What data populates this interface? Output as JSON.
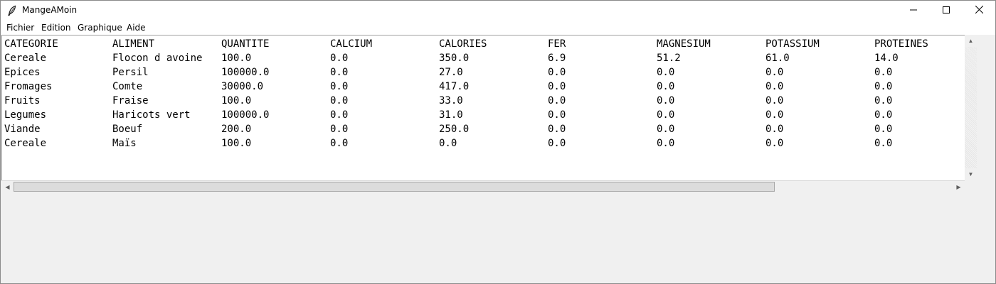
{
  "window": {
    "title": "MangeAMoin"
  },
  "menu": [
    "Fichier",
    "Edition",
    "Graphique",
    "Aide"
  ],
  "table": {
    "headers": [
      "CATEGORIE",
      "ALIMENT",
      "QUANTITE",
      "CALCIUM",
      "CALORIES",
      "FER",
      "MAGNESIUM",
      "POTASSIUM",
      "PROTEINES"
    ],
    "rows": [
      [
        "Cereale",
        "Flocon d avoine",
        "100.0",
        "0.0",
        "350.0",
        "6.9",
        "51.2",
        "61.0",
        "14.0"
      ],
      [
        "Epices",
        "Persil",
        "100000.0",
        "0.0",
        "27.0",
        "0.0",
        "0.0",
        "0.0",
        "0.0"
      ],
      [
        "Fromages",
        "Comte",
        "30000.0",
        "0.0",
        "417.0",
        "0.0",
        "0.0",
        "0.0",
        "0.0"
      ],
      [
        "Fruits",
        "Fraise",
        "100.0",
        "0.0",
        "33.0",
        "0.0",
        "0.0",
        "0.0",
        "0.0"
      ],
      [
        "Legumes",
        "Haricots vert",
        "100000.0",
        "0.0",
        "31.0",
        "0.0",
        "0.0",
        "0.0",
        "0.0"
      ],
      [
        "Viande",
        "Boeuf",
        "200.0",
        "0.0",
        "250.0",
        "0.0",
        "0.0",
        "0.0",
        "0.0"
      ],
      [
        "Cereale",
        "Maïs",
        "100.0",
        "0.0",
        "0.0",
        "0.0",
        "0.0",
        "0.0",
        "0.0"
      ]
    ]
  },
  "icons": {
    "app": "feather-icon",
    "minimize": "minimize-icon",
    "maximize": "maximize-icon",
    "close": "close-icon",
    "scroll_up": "arrow-up-icon",
    "scroll_down": "arrow-down-icon",
    "scroll_left": "arrow-left-icon",
    "scroll_right": "arrow-right-icon"
  }
}
